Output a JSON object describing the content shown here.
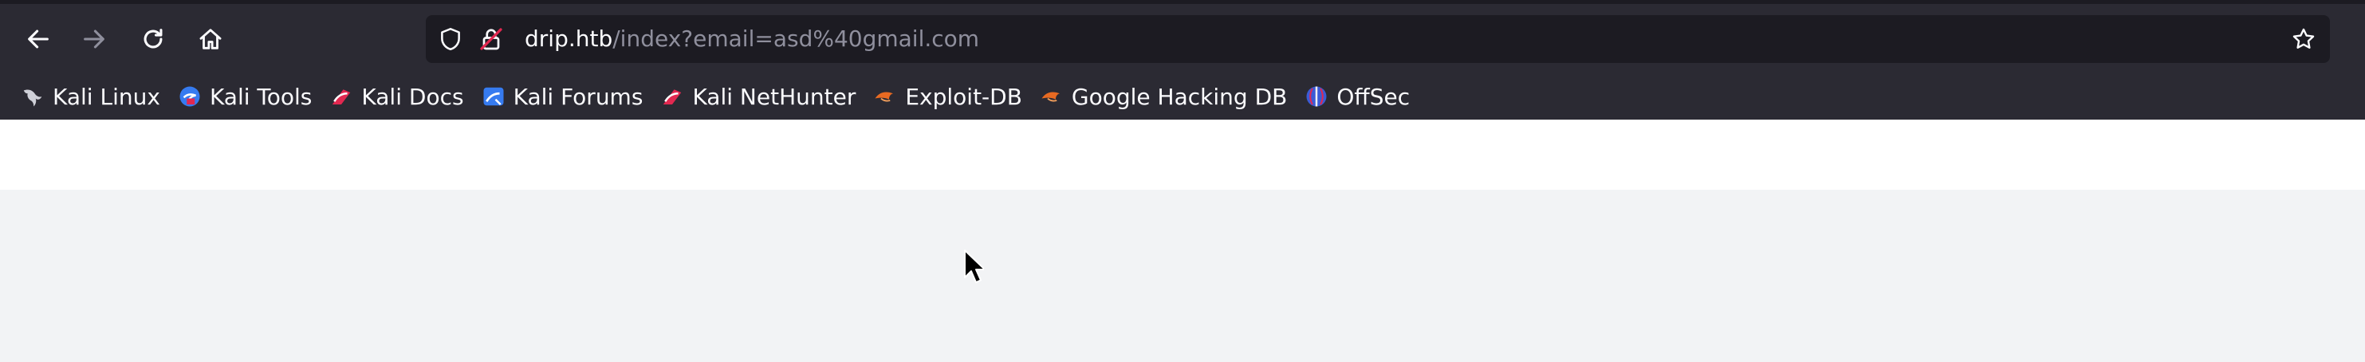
{
  "browser": {
    "url_host": "drip.htb",
    "url_path": "/index?email=asd%40gmail.com"
  },
  "bookmarks": [
    {
      "label": "Kali Linux",
      "icon": "kali-dragon-icon"
    },
    {
      "label": "Kali Tools",
      "icon": "kali-tools-icon"
    },
    {
      "label": "Kali Docs",
      "icon": "kali-docs-icon"
    },
    {
      "label": "Kali Forums",
      "icon": "kali-forums-icon"
    },
    {
      "label": "Kali NetHunter",
      "icon": "kali-nethunter-icon"
    },
    {
      "label": "Exploit-DB",
      "icon": "exploit-db-icon"
    },
    {
      "label": "Google Hacking DB",
      "icon": "ghdb-icon"
    },
    {
      "label": "OffSec",
      "icon": "offsec-icon"
    }
  ],
  "colors": {
    "chrome": "#2b2a33",
    "urlbar": "#1c1b22",
    "page_background": "#f2f3f5",
    "page_header": "#ffffff"
  }
}
